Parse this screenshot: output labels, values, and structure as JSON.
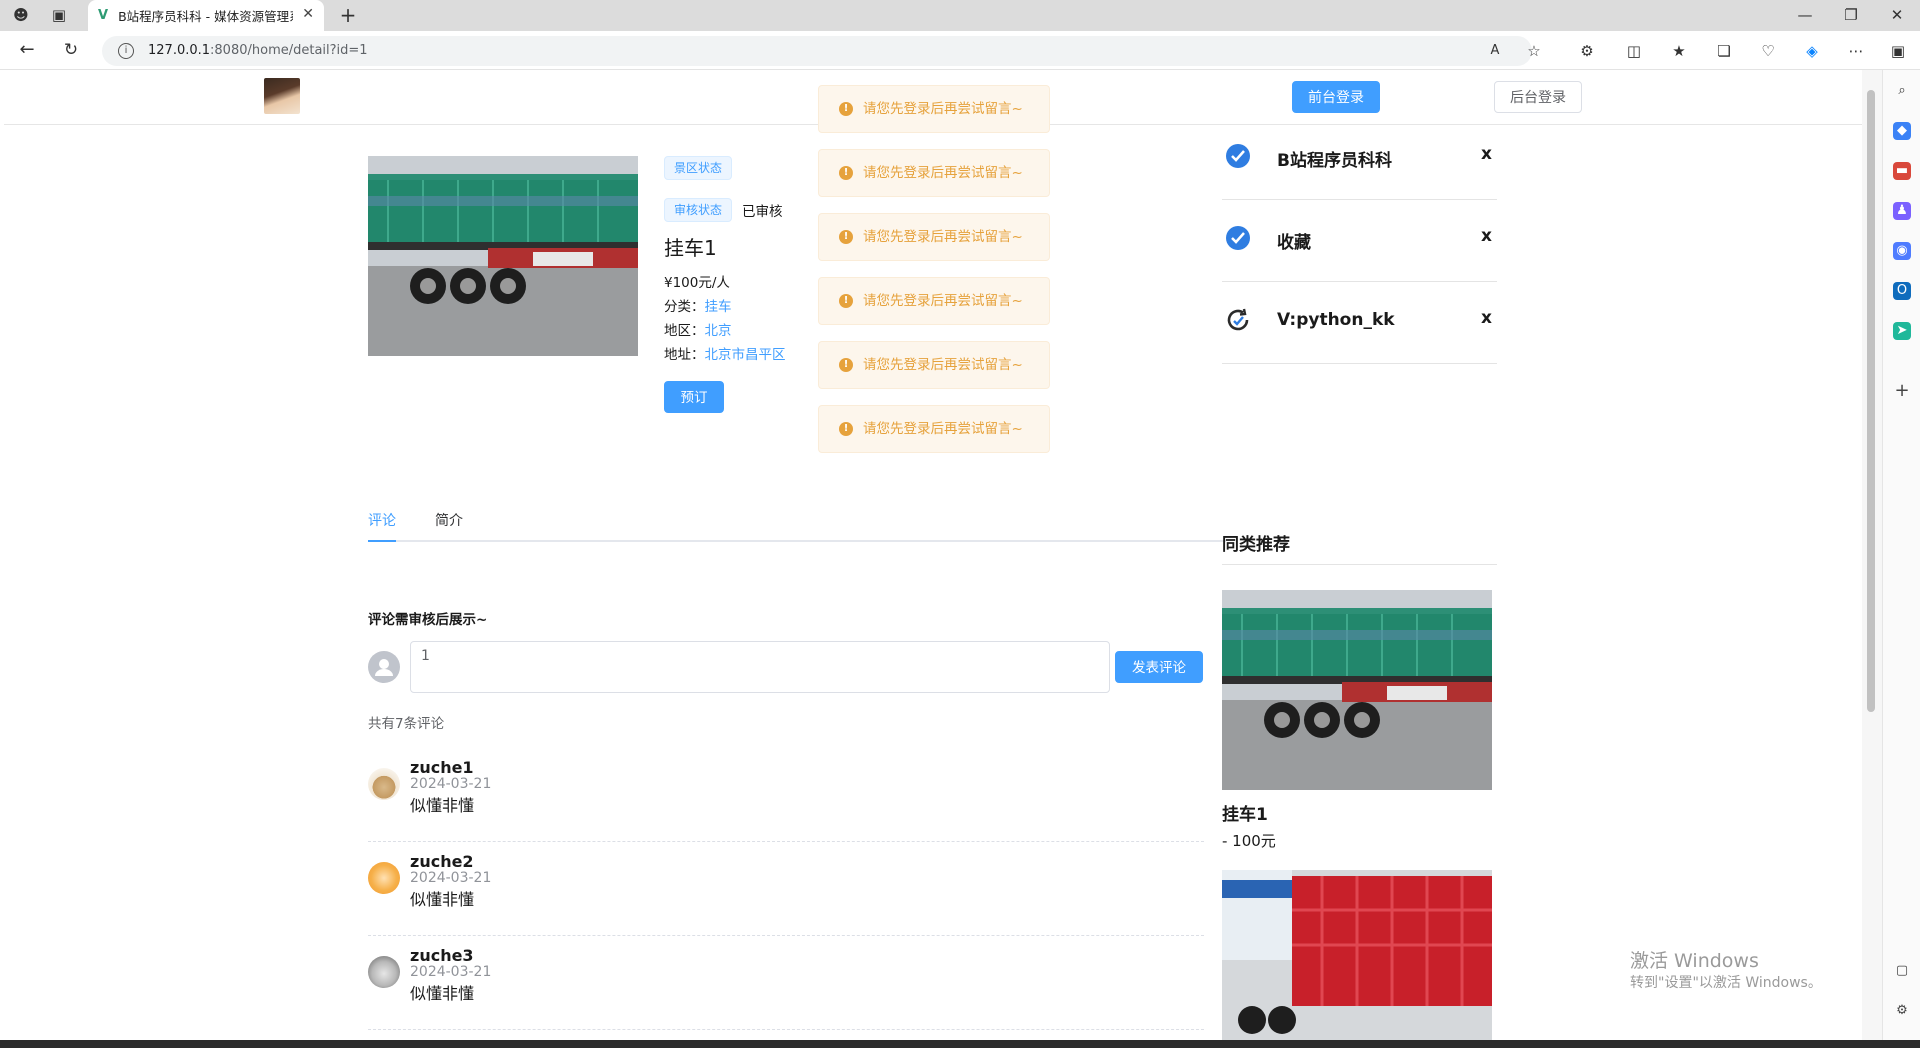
{
  "browser": {
    "tab_title": "B站程序员科科 - 媒体资源管理系",
    "url_host": "127.0.0.1",
    "url_rest": ":8080/home/detail?id=1"
  },
  "header": {
    "front_login": "前台登录",
    "back_login": "后台登录"
  },
  "toasts": [
    "请您先登录后再尝试留言~",
    "请您先登录后再尝试留言~",
    "请您先登录后再尝试留言~",
    "请您先登录后再尝试留言~",
    "请您先登录后再尝试留言~",
    "请您先登录后再尝试留言~"
  ],
  "detail": {
    "scenic_tag": "景区状态",
    "audit_tag": "审核状态",
    "audit_value": "已审核",
    "title": "挂车1",
    "price": "¥100元/人",
    "category_label": "分类：",
    "category_value": "挂车",
    "region_label": "地区：",
    "region_value": "北京",
    "address_label": "地址：",
    "address_value": "北京市昌平区",
    "book_button": "预订"
  },
  "side_menu": [
    {
      "label": "B站程序员科科",
      "close": "x",
      "icon": "badge-check-icon"
    },
    {
      "label": "收藏",
      "close": "x",
      "icon": "badge-check-icon"
    },
    {
      "label": "V:python_kk",
      "close": "x",
      "icon": "refresh-icon"
    }
  ],
  "tabs": [
    "评论",
    "简介"
  ],
  "comment_section": {
    "notice": "评论需审核后展示~",
    "input_value": "1",
    "submit": "发表评论",
    "count_text": "共有7条评论"
  },
  "comments": [
    {
      "name": "zuche1",
      "date": "2024-03-21",
      "text": "似懂非懂"
    },
    {
      "name": "zuche2",
      "date": "2024-03-21",
      "text": "似懂非懂"
    },
    {
      "name": "zuche3",
      "date": "2024-03-21",
      "text": "似懂非懂"
    }
  ],
  "recommend": {
    "heading": "同类推荐",
    "items": [
      {
        "title": "挂车1",
        "price": "- 100元"
      }
    ]
  },
  "watermark": {
    "line1": "激活 Windows",
    "line2": "转到\"设置\"以激活 Windows。"
  },
  "colors": {
    "primary": "#409eff",
    "warning": "#e6a23c",
    "trailer_green": "#1e8c6d",
    "trailer_red": "#c8202a"
  }
}
